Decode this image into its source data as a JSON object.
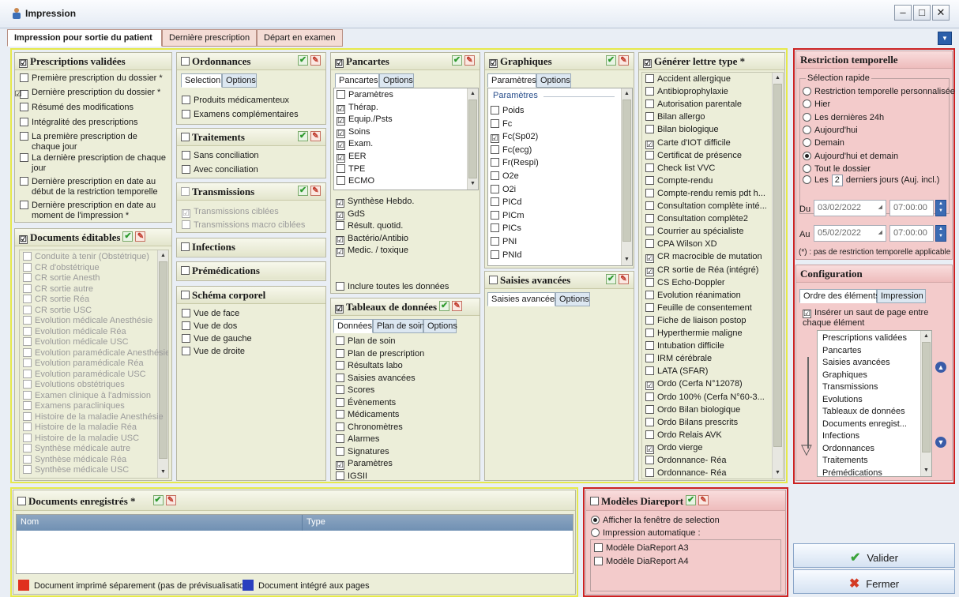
{
  "window": {
    "title": "Impression",
    "min": "–",
    "max": "□",
    "close": "✕"
  },
  "main_tabs": [
    "Impression pour sortie du patient",
    "Dernière prescription",
    "Départ en examen"
  ],
  "prescriptions": {
    "title": "Prescriptions validées",
    "checked": true,
    "items": [
      {
        "label": "Première prescription du dossier *",
        "checked": false
      },
      {
        "label": "Dernière prescription du dossier *",
        "checked": true
      },
      {
        "label": "Résumé des modifications",
        "checked": false
      },
      {
        "label": "Intégralité des prescriptions",
        "checked": false
      },
      {
        "label": "La première prescription de chaque jour",
        "checked": false
      },
      {
        "label": "La dernière prescription de chaque jour",
        "checked": false
      },
      {
        "label": "Dernière prescription en date au début de la restriction temporelle",
        "checked": false
      },
      {
        "label": "Dernière prescription en date au moment de l'impression *",
        "checked": false
      }
    ]
  },
  "documents_editables": {
    "title": "Documents éditables",
    "checked": true,
    "items": [
      "Conduite à tenir (Obstétrique)",
      "CR d'obstétrique",
      "CR sortie Anesth",
      "CR sortie autre",
      "CR sortie Réa",
      "CR sortie USC",
      "Evolution médicale Anesthésie",
      "Evolution médicale Réa",
      "Evolution médicale USC",
      "Evolution paramédicale Anesthésie",
      "Evolution paramédicale Réa",
      "Evolution paramédicale USC",
      "Evolutions obstétriques",
      "Examen clinique à l'admission",
      "Examens paracliniques",
      "Histoire de la maladie Anesthésie",
      "Histoire de la maladie Réa",
      "Histoire de la maladie USC",
      "Synthèse médicale autre",
      "Synthèse médicale Réa",
      "Synthèse médicale USC"
    ]
  },
  "ordonnances": {
    "title": "Ordonnances",
    "checked": false,
    "tabs": [
      "Selection",
      "Options"
    ],
    "items": [
      "Produits médicamenteux",
      "Examens complémentaires"
    ]
  },
  "traitements": {
    "title": "Traitements",
    "checked": false,
    "items": [
      "Sans conciliation",
      "Avec conciliation"
    ]
  },
  "transmissions": {
    "title": "Transmissions",
    "checked": false,
    "items": [
      "Transmissions ciblées",
      "Transmissions macro ciblées"
    ]
  },
  "infections": {
    "title": "Infections"
  },
  "premedications": {
    "title": "Prémédications"
  },
  "schema": {
    "title": "Schéma corporel",
    "items": [
      "Vue de face",
      "Vue de dos",
      "Vue de gauche",
      "Vue de droite"
    ]
  },
  "pancartes": {
    "title": "Pancartes",
    "checked": true,
    "tabs": [
      "Pancartes",
      "Options"
    ],
    "items": [
      {
        "label": "Paramètres",
        "checked": false
      },
      {
        "label": "Thérap.",
        "checked": true
      },
      {
        "label": "Equip./Psts",
        "checked": true
      },
      {
        "label": "Soins",
        "checked": true
      },
      {
        "label": "Exam.",
        "checked": true
      },
      {
        "label": "EER",
        "checked": true
      },
      {
        "label": "TPE",
        "checked": false
      },
      {
        "label": "ECMO",
        "checked": false
      }
    ],
    "items2": [
      {
        "label": "Synthèse Hebdo.",
        "checked": true
      },
      {
        "label": "GdS",
        "checked": true
      },
      {
        "label": "Résult. quotid.",
        "checked": false
      },
      {
        "label": "Bactério/Antibio",
        "checked": true
      },
      {
        "label": "Medic. / toxique",
        "checked": true
      }
    ],
    "include_all": "Inclure toutes les données"
  },
  "tableaux": {
    "title": "Tableaux de données",
    "checked": true,
    "tabs": [
      "Données",
      "Plan de soin",
      "Options"
    ],
    "items": [
      {
        "label": "Plan de soin",
        "checked": false
      },
      {
        "label": "Plan de prescription",
        "checked": false
      },
      {
        "label": "Résultats labo",
        "checked": false
      },
      {
        "label": "Saisies avancées",
        "checked": false
      },
      {
        "label": "Scores",
        "checked": false
      },
      {
        "label": "Évènements",
        "checked": false
      },
      {
        "label": "Médicaments",
        "checked": false
      },
      {
        "label": "Chronomètres",
        "checked": false
      },
      {
        "label": "Alarmes",
        "checked": false
      },
      {
        "label": "Signatures",
        "checked": false
      },
      {
        "label": "Paramètres",
        "checked": true
      },
      {
        "label": "IGSII",
        "checked": false
      }
    ]
  },
  "graphiques": {
    "title": "Graphiques",
    "checked": true,
    "tabs": [
      "Paramètres",
      "Options"
    ],
    "group": "Paramètres",
    "items": [
      {
        "label": "Poids",
        "checked": false
      },
      {
        "label": "Fc",
        "checked": false
      },
      {
        "label": "Fc(Sp02)",
        "checked": true
      },
      {
        "label": "Fc(ecg)",
        "checked": false
      },
      {
        "label": "Fr(Respi)",
        "checked": false
      },
      {
        "label": "O2e",
        "checked": false
      },
      {
        "label": "O2i",
        "checked": false
      },
      {
        "label": "PICd",
        "checked": false
      },
      {
        "label": "PICm",
        "checked": false
      },
      {
        "label": "PICs",
        "checked": false
      },
      {
        "label": "PNI",
        "checked": false
      },
      {
        "label": "PNId",
        "checked": false
      }
    ]
  },
  "saisies": {
    "title": "Saisies avancées",
    "checked": false,
    "tabs": [
      "Saisies avancées",
      "Options"
    ]
  },
  "lettre": {
    "title": "Générer lettre type *",
    "checked": true,
    "items": [
      {
        "label": "Accident allergique",
        "checked": false
      },
      {
        "label": "Antibioprophylaxie",
        "checked": false
      },
      {
        "label": "Autorisation parentale",
        "checked": false
      },
      {
        "label": "Bilan allergo",
        "checked": false
      },
      {
        "label": "Bilan biologique",
        "checked": false
      },
      {
        "label": "Carte d'IOT difficile",
        "checked": true
      },
      {
        "label": "Certificat de présence",
        "checked": false
      },
      {
        "label": "Check list VVC",
        "checked": false
      },
      {
        "label": "Compte-rendu",
        "checked": false
      },
      {
        "label": "Compte-rendu remis pdt h...",
        "checked": false
      },
      {
        "label": "Consultation complète inté...",
        "checked": false
      },
      {
        "label": "Consultation complète2",
        "checked": false
      },
      {
        "label": "Courrier au spécialiste",
        "checked": false
      },
      {
        "label": "CPA Wilson XD",
        "checked": false
      },
      {
        "label": "CR macrocible de mutation",
        "checked": true
      },
      {
        "label": "CR sortie de Réa (intégré)",
        "checked": true
      },
      {
        "label": "CS Echo-Doppler",
        "checked": false
      },
      {
        "label": "Evolution réanimation",
        "checked": false
      },
      {
        "label": "Feuille de consentement",
        "checked": false
      },
      {
        "label": "Fiche de liaison postop",
        "checked": false
      },
      {
        "label": "Hyperthermie maligne",
        "checked": false
      },
      {
        "label": "Intubation difficile",
        "checked": false
      },
      {
        "label": "IRM cérébrale",
        "checked": false
      },
      {
        "label": "LATA (SFAR)",
        "checked": false
      },
      {
        "label": "Ordo (Cerfa N°12078)",
        "checked": true
      },
      {
        "label": "Ordo 100% (Cerfa N°60-3...",
        "checked": false
      },
      {
        "label": "Ordo Bilan biologique",
        "checked": false
      },
      {
        "label": "Ordo Bilans prescrits",
        "checked": false
      },
      {
        "label": "Ordo Relais AVK",
        "checked": false
      },
      {
        "label": "Ordo vierge",
        "checked": true
      },
      {
        "label": "Ordonnance- Réa",
        "checked": false
      },
      {
        "label": "Ordonnance- Réa",
        "checked": false
      }
    ]
  },
  "restriction": {
    "title": "Restriction temporelle",
    "group": "Sélection rapide",
    "options": [
      {
        "label": "Restriction temporelle personnalisée",
        "on": false
      },
      {
        "label": "Hier",
        "on": false
      },
      {
        "label": "Les dernières 24h",
        "on": false
      },
      {
        "label": "Aujourd'hui",
        "on": false
      },
      {
        "label": "Demain",
        "on": false
      },
      {
        "label": "Aujourd'hui et demain",
        "on": true
      },
      {
        "label": "Tout le dossier",
        "on": false
      }
    ],
    "les_label": "Les",
    "les_value": "2",
    "les_suffix": "derniers jours (Auj. incl.)",
    "du": "Du",
    "du_date": "03/02/2022",
    "du_time": "07:00:00",
    "au": "Au",
    "au_date": "05/02/2022",
    "au_time": "07:00:00",
    "note": "(*) : pas de restriction temporelle applicable"
  },
  "configuration": {
    "title": "Configuration",
    "tabs": [
      "Ordre des éléments",
      "Impression"
    ],
    "page_break": "Insérer un saut de page entre chaque élément",
    "order": [
      "Prescriptions validées",
      "Pancartes",
      "Saisies avancées",
      "Graphiques",
      "Transmissions",
      "Evolutions",
      "Tableaux de données",
      "Documents enregist...",
      "Infections",
      "Ordonnances",
      "Traitements",
      "Prémédications"
    ]
  },
  "docs_enregistres": {
    "title": "Documents enregistrés *",
    "checked": false,
    "col_nom": "Nom",
    "col_type": "Type",
    "legend1": "Document imprimé séparement (pas de prévisualisation)",
    "legend1_color": "#e0301e",
    "legend2": "Document intégré aux pages",
    "legend2_color": "#2a3fbf"
  },
  "diareport": {
    "title": "Modèles Diareport",
    "checked": false,
    "options": [
      {
        "label": "Afficher la fenêtre de selection",
        "on": true
      },
      {
        "label": "Impression automatique :",
        "on": false
      }
    ],
    "models": [
      "Modèle DiaReport A3",
      "Modèle DiaReport A4"
    ]
  },
  "buttons": {
    "valider": "Valider",
    "fermer": "Fermer"
  },
  "icons": {
    "ok": "checkmark-icon",
    "edit": "pencil-icon"
  },
  "colors": {
    "panel": "#eceed9",
    "pink": "#f3cbcb",
    "yellow_frame": "#e6e94a",
    "red_frame": "#cc2222"
  }
}
